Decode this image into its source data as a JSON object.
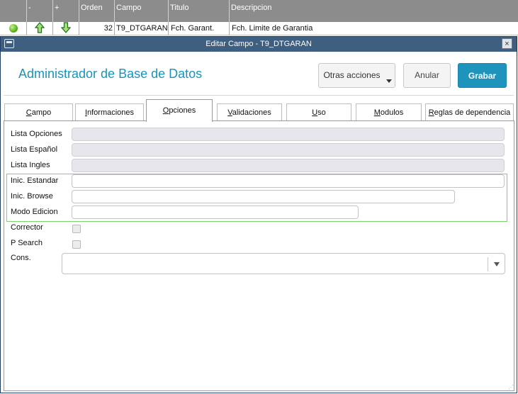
{
  "grid": {
    "columns": {
      "blank": "",
      "minus": "-",
      "plus": "+",
      "orden": "Orden",
      "campo": "Campo",
      "titulo": "Titulo",
      "descripcion": "Descripcion"
    },
    "row": {
      "orden": "32",
      "campo": "T9_DTGARAN",
      "titulo": "Fch. Garant.",
      "descripcion": "Fch. Limite de Garantia",
      "status_color": "#5ab21e"
    }
  },
  "dialog": {
    "title": "Editar Campo - T9_DTGARAN",
    "close_label": "×",
    "header_title": "Administrador de Base de Datos",
    "buttons": {
      "more": "Otras acciones",
      "cancel": "Anular",
      "save": "Grabar"
    },
    "tabs": [
      {
        "prefix": "",
        "underlined": "C",
        "rest": "ampo"
      },
      {
        "prefix": "",
        "underlined": "I",
        "rest": "nformaciones"
      },
      {
        "prefix": "",
        "underlined": "O",
        "rest": "pciones"
      },
      {
        "prefix": "",
        "underlined": "V",
        "rest": "alidaciones"
      },
      {
        "prefix": "",
        "underlined": "U",
        "rest": "so"
      },
      {
        "prefix": "",
        "underlined": "M",
        "rest": "odulos"
      },
      {
        "prefix": "",
        "underlined": "R",
        "rest": "eglas de dependencia"
      }
    ],
    "active_tab": "Opciones",
    "fields": {
      "lista_opciones": {
        "label": "Lista Opciones",
        "value": ""
      },
      "lista_espanol": {
        "label": "Lista Español",
        "value": ""
      },
      "lista_ingles": {
        "label": "Lista Ingles",
        "value": ""
      },
      "inic_estandar": {
        "label": "Inic. Estandar",
        "value": ""
      },
      "inic_browse": {
        "label": "Inic. Browse",
        "value": ""
      },
      "modo_edicion": {
        "label": "Modo Edicion",
        "value": ""
      },
      "corrector": {
        "label": "Corrector",
        "checked": false
      },
      "p_search": {
        "label": "P Search",
        "checked": false
      },
      "cons": {
        "label": "Cons.",
        "value": ""
      }
    }
  },
  "colors": {
    "accent": "#1e93bb",
    "titlebar": "#3f5f80",
    "highlight": "#7ed36a"
  }
}
